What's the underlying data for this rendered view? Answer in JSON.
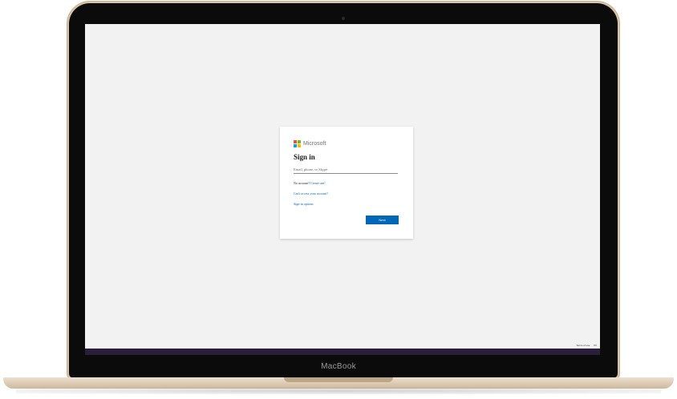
{
  "device": {
    "brand_label": "MacBook"
  },
  "signin": {
    "brand": "Microsoft",
    "brand_colors": [
      "#f25022",
      "#7fba00",
      "#00a4ef",
      "#ffb900"
    ],
    "title": "Sign in",
    "email_placeholder": "Email, phone, or Skype",
    "no_account_text": "No account?",
    "create_link": "Create one!",
    "cant_access_link": "Can't access your account?",
    "signin_options_link": "Sign-in options",
    "next_button": "Next",
    "accent_color": "#0067b8"
  },
  "footer": {
    "terms": "Terms of use",
    "privacy": "Pri"
  }
}
